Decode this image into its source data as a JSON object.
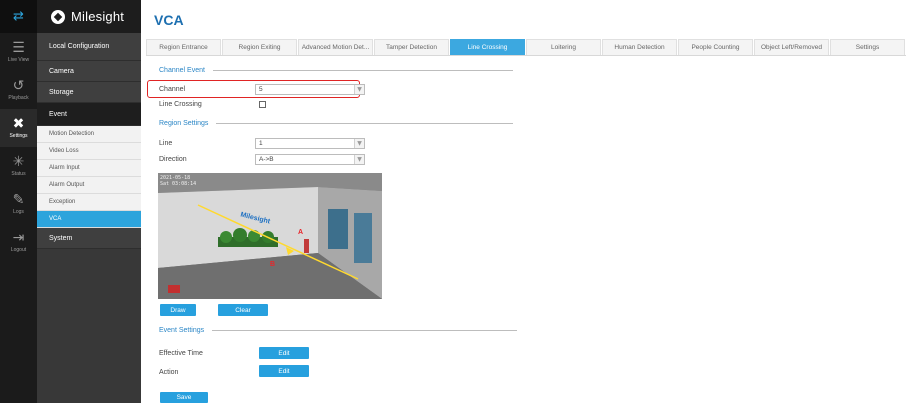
{
  "rail": {
    "items": [
      {
        "icon": "arrows-switch-icon",
        "label": ""
      },
      {
        "icon": "live-view-icon",
        "label": "Live View"
      },
      {
        "icon": "playback-icon",
        "label": "Playback"
      },
      {
        "icon": "settings-tools-icon",
        "label": "Settings"
      },
      {
        "icon": "status-icon",
        "label": "Status"
      },
      {
        "icon": "logs-icon",
        "label": "Logs"
      },
      {
        "icon": "logout-icon",
        "label": "Logout"
      }
    ]
  },
  "brand": {
    "name": "Milesight"
  },
  "menu": {
    "local_configuration": "Local Configuration",
    "camera": "Camera",
    "storage": "Storage",
    "event": "Event",
    "event_items": [
      "Motion Detection",
      "Video Loss",
      "Alarm Input",
      "Alarm Output",
      "Exception",
      "VCA"
    ],
    "system": "System"
  },
  "page": {
    "title": "VCA"
  },
  "tabs": [
    "Region Entrance",
    "Region Exiting",
    "Advanced Motion Det...",
    "Tamper Detection",
    "Line Crossing",
    "Loitering",
    "Human Detection",
    "People Counting",
    "Object Left/Removed",
    "Settings"
  ],
  "active_tab": "Line Crossing",
  "channel_event": {
    "section": "Channel Event",
    "channel_label": "Channel",
    "channel_value": "5",
    "line_crossing_label": "Line Crossing",
    "line_crossing_checked": false
  },
  "region_settings": {
    "section": "Region Settings",
    "line_label": "Line",
    "line_value": "1",
    "direction_label": "Direction",
    "direction_value": "A->B"
  },
  "video": {
    "osd_line1": "2021-05-18",
    "osd_line2": "Sat 03:08:14",
    "wall_logo": "Milesight",
    "marker_a": "A",
    "marker_b": "B"
  },
  "buttons": {
    "draw": "Draw",
    "clear": "Clear",
    "edit1": "Edit",
    "edit2": "Edit",
    "save": "Save"
  },
  "event_settings": {
    "section": "Event Settings",
    "effective_time_label": "Effective Time",
    "action_label": "Action"
  },
  "colors": {
    "accent": "#2da4dc",
    "title": "#1d6fb0",
    "highlight": "#e02424"
  }
}
